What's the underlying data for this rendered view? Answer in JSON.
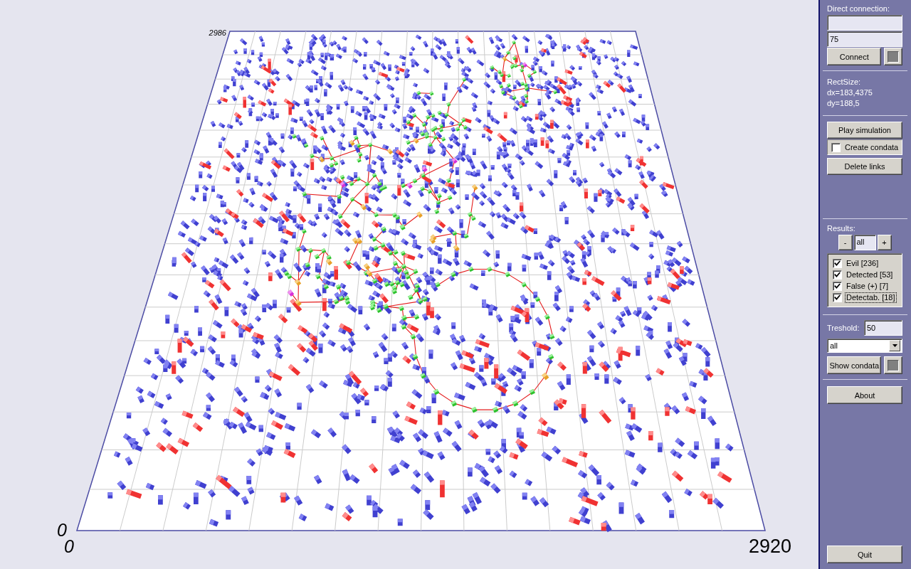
{
  "plot": {
    "labels": [
      {
        "kind": "y-max",
        "text": "2986"
      },
      {
        "kind": "y-origin",
        "text": "0"
      },
      {
        "kind": "x-origin",
        "text": "0"
      },
      {
        "kind": "x-max",
        "text": "2920"
      }
    ]
  },
  "sidebar": {
    "connection": {
      "label": "Direct connection:",
      "port": "75",
      "connect_button": "Connect"
    },
    "rect_size": {
      "label": "RectSize:",
      "lines": [
        "dx=183,4375",
        "dy=188,5"
      ]
    },
    "actions": [
      {
        "kind": "button",
        "label": "Play simulation"
      },
      {
        "kind": "checkbox",
        "label": "Create condata",
        "checked": false
      },
      {
        "kind": "button",
        "label": "Delete links"
      }
    ],
    "results": {
      "label": "Results:",
      "decrement": "-",
      "filter": "all",
      "increment": "+",
      "items": [
        {
          "label": "Evil [236]",
          "checked": true,
          "focused": false
        },
        {
          "label": "Detected [53]",
          "checked": true,
          "focused": false
        },
        {
          "label": "False (+) [7]",
          "checked": true,
          "focused": false
        },
        {
          "label": "Detectab. [18]",
          "checked": true,
          "focused": true
        }
      ]
    },
    "threshold": {
      "label": "Treshold:",
      "value": "50"
    },
    "display_select": {
      "value": "all"
    },
    "show_condata_button": "Show condata",
    "about_button": "About",
    "quit_button": "Quit"
  }
}
